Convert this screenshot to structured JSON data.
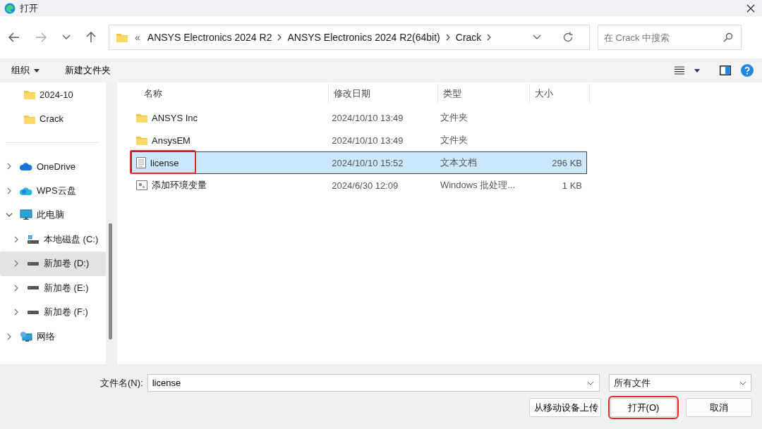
{
  "window": {
    "title": "打开"
  },
  "breadcrumb": {
    "overflow": "«",
    "segments": [
      "ANSYS Electronics 2024 R2",
      "ANSYS Electronics 2024 R2(64bit)",
      "Crack"
    ]
  },
  "search": {
    "placeholder": "在 Crack 中搜索"
  },
  "toolbar": {
    "organize": "组织",
    "new_folder": "新建文件夹"
  },
  "sidebar": {
    "quick_access": [
      {
        "label": "2024-10",
        "kind": "folder"
      },
      {
        "label": "Crack",
        "kind": "folder"
      }
    ],
    "tree": [
      {
        "label": "OneDrive",
        "kind": "cloud",
        "expanded": false,
        "selected": false
      },
      {
        "label": "WPS云盘",
        "kind": "cloud-wps",
        "expanded": false,
        "selected": false
      },
      {
        "label": "此电脑",
        "kind": "pc",
        "expanded": true,
        "selected": false,
        "children": [
          {
            "label": "本地磁盘 (C:)",
            "kind": "drive-system",
            "expanded": false,
            "selected": false
          },
          {
            "label": "新加卷 (D:)",
            "kind": "drive",
            "expanded": false,
            "selected": true
          },
          {
            "label": "新加卷 (E:)",
            "kind": "drive",
            "expanded": false,
            "selected": false
          },
          {
            "label": "新加卷 (F:)",
            "kind": "drive",
            "expanded": false,
            "selected": false
          }
        ]
      },
      {
        "label": "网络",
        "kind": "network",
        "expanded": false,
        "selected": false
      }
    ]
  },
  "table": {
    "columns": [
      "名称",
      "修改日期",
      "类型",
      "大小"
    ],
    "rows": [
      {
        "name": "ANSYS Inc",
        "date": "2024/10/10 13:49",
        "type": "文件夹",
        "kind": "folder",
        "selected": false,
        "highlighted": false
      },
      {
        "name": "AnsysEM",
        "date": "2024/10/10 13:49",
        "type": "文件夹",
        "kind": "folder",
        "selected": false,
        "highlighted": false
      },
      {
        "name": "license",
        "date": "2024/10/10 15:52",
        "type": "文本文档",
        "size": "296 KB",
        "kind": "text",
        "selected": true,
        "highlighted": true
      },
      {
        "name": "添加环境变量",
        "date": "2024/6/30 12:09",
        "type": "Windows 批处理...",
        "size": "1 KB",
        "kind": "batch",
        "selected": false,
        "highlighted": false
      }
    ]
  },
  "footer": {
    "filename_label": "文件名(N):",
    "filename_value": "license",
    "filter": "所有文件",
    "buttons": [
      {
        "label": "从移动设备上传",
        "highlighted": false
      },
      {
        "label": "打开(O)",
        "highlighted": true
      },
      {
        "label": "取消",
        "highlighted": false
      }
    ]
  }
}
